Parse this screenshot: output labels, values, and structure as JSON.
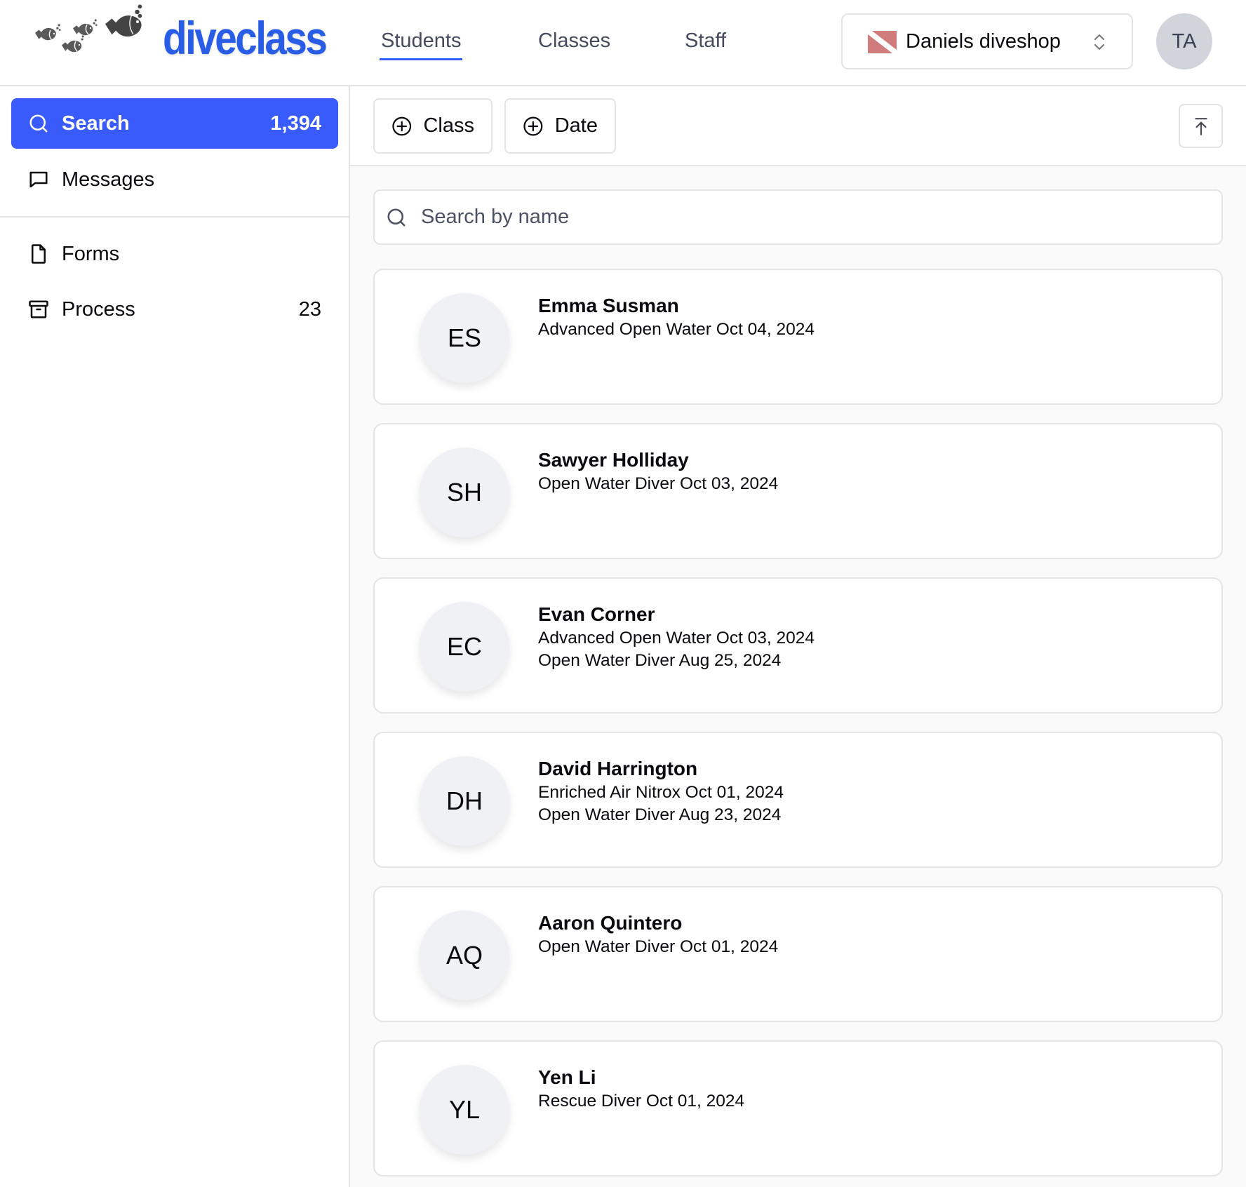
{
  "brand": {
    "name": "diveclass",
    "color": "#2a5de6",
    "logo_icon": "fish-school-icon"
  },
  "nav": {
    "tabs": [
      {
        "label": "Students",
        "active": true
      },
      {
        "label": "Classes",
        "active": false
      },
      {
        "label": "Staff",
        "active": false
      }
    ]
  },
  "shop_selector": {
    "icon": "dive-flag-icon",
    "value": "Daniels diveshop",
    "chevron": "chevron-up-down-icon"
  },
  "user": {
    "initials": "TA"
  },
  "sidebar": {
    "items": [
      {
        "label": "Search",
        "icon": "search-icon",
        "count": "1,394",
        "active": true
      },
      {
        "label": "Messages",
        "icon": "message-square-icon",
        "count": "",
        "active": false
      },
      {
        "label": "Forms",
        "icon": "file-icon",
        "count": "",
        "active": false
      },
      {
        "label": "Process",
        "icon": "archive-icon",
        "count": "23",
        "active": false
      }
    ],
    "accent": "#3a5bfc"
  },
  "toolbar": {
    "filters": [
      {
        "label": "Class",
        "icon": "plus-circle-icon"
      },
      {
        "label": "Date",
        "icon": "plus-circle-icon"
      }
    ],
    "scroll_top_icon": "arrow-up-to-line-icon"
  },
  "search": {
    "placeholder": "Search by name",
    "value": ""
  },
  "students": [
    {
      "initials": "ES",
      "name": "Emma Susman",
      "certs": [
        "Advanced Open Water Oct 04, 2024"
      ]
    },
    {
      "initials": "SH",
      "name": "Sawyer Holliday",
      "certs": [
        "Open Water Diver Oct 03, 2024"
      ]
    },
    {
      "initials": "EC",
      "name": "Evan Corner",
      "certs": [
        "Advanced Open Water Oct 03, 2024",
        "Open Water Diver Aug 25, 2024"
      ]
    },
    {
      "initials": "DH",
      "name": "David Harrington",
      "certs": [
        "Enriched Air Nitrox Oct 01, 2024",
        "Open Water Diver Aug 23, 2024"
      ]
    },
    {
      "initials": "AQ",
      "name": "Aaron Quintero",
      "certs": [
        "Open Water Diver Oct 01, 2024"
      ]
    },
    {
      "initials": "YL",
      "name": "Yen Li",
      "certs": [
        "Rescue Diver Oct 01, 2024"
      ]
    }
  ]
}
